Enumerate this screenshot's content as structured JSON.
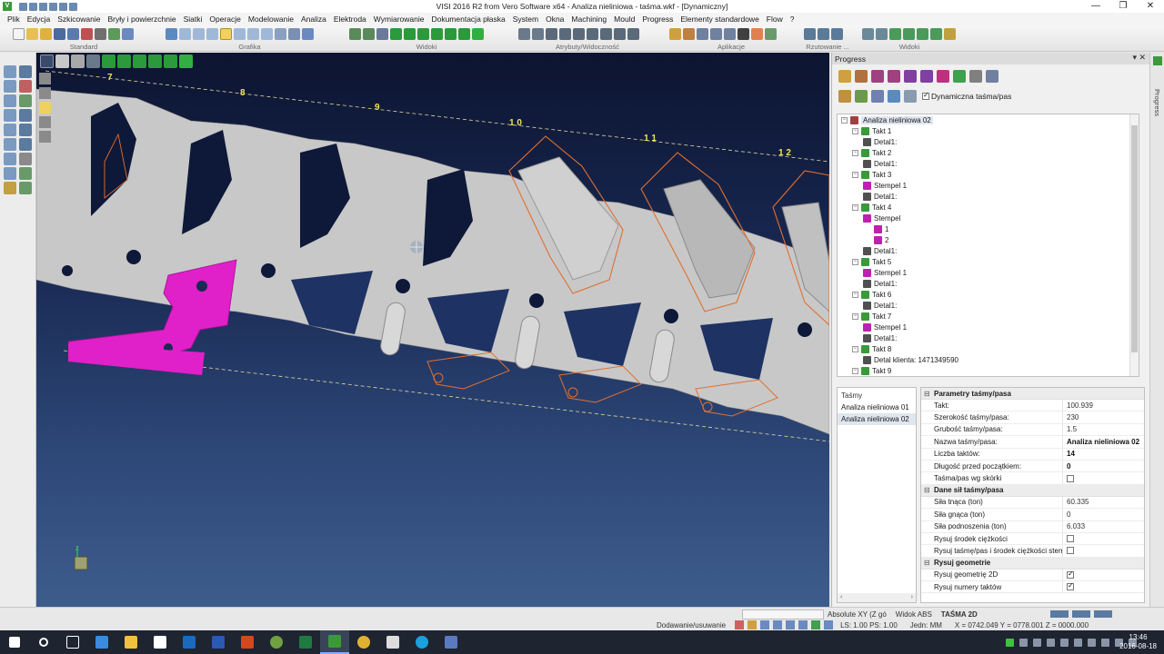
{
  "window": {
    "title": "VISI 2016 R2 from Vero Software x64 - Analiza nieliniowa - taśma.wkf - [Dynamiczny]",
    "minimize": "—",
    "maximize": "❐",
    "close": "✕"
  },
  "menu": [
    "Plik",
    "Edycja",
    "Szkicowanie",
    "Bryły i powierzchnie",
    "Siatki",
    "Operacje",
    "Modelowanie",
    "Analiza",
    "Elektroda",
    "Wymiarowanie",
    "Dokumentacja płaska",
    "System",
    "Okna",
    "Machining",
    "Mould",
    "Progress",
    "Elementy standardowe",
    "Flow",
    "?"
  ],
  "toolbar_groups": [
    "Standard",
    "Grafika",
    "Widoki",
    "Atrybuty/Widoczność",
    "Aplikacje",
    "Rzutowanie ...",
    "Widoki"
  ],
  "viewport": {
    "takt_labels": [
      "7",
      "8",
      "9",
      "1 0",
      "1 1",
      "1 2"
    ],
    "axis_label": "Z"
  },
  "progress_panel": {
    "title": "Progress",
    "panel_controls": "▾ ✕",
    "dynamic_checkbox_label": "Dynamiczna taśma/pas",
    "dynamic_checked": true,
    "tree": [
      {
        "label": "Analiza nieliniowa 02",
        "level": 0,
        "kind": "root"
      },
      {
        "label": "Takt 1",
        "level": 1,
        "kind": "takt"
      },
      {
        "label": "Detal1:",
        "level": 2,
        "kind": "detal"
      },
      {
        "label": "Takt 2",
        "level": 1,
        "kind": "takt"
      },
      {
        "label": "Detal1:",
        "level": 2,
        "kind": "detal"
      },
      {
        "label": "Takt 3",
        "level": 1,
        "kind": "takt"
      },
      {
        "label": "Stempel 1",
        "level": 2,
        "kind": "stempel"
      },
      {
        "label": "Detal1:",
        "level": 2,
        "kind": "detal"
      },
      {
        "label": "Takt 4",
        "level": 1,
        "kind": "takt"
      },
      {
        "label": "Stempel",
        "level": 2,
        "kind": "stempel"
      },
      {
        "label": "1",
        "level": 3,
        "kind": "stempel"
      },
      {
        "label": "2",
        "level": 3,
        "kind": "stempel"
      },
      {
        "label": "Detal1:",
        "level": 2,
        "kind": "detal"
      },
      {
        "label": "Takt 5",
        "level": 1,
        "kind": "takt"
      },
      {
        "label": "Stempel 1",
        "level": 2,
        "kind": "stempel"
      },
      {
        "label": "Detal1:",
        "level": 2,
        "kind": "detal"
      },
      {
        "label": "Takt 6",
        "level": 1,
        "kind": "takt"
      },
      {
        "label": "Detal1:",
        "level": 2,
        "kind": "detal"
      },
      {
        "label": "Takt 7",
        "level": 1,
        "kind": "takt"
      },
      {
        "label": "Stempel 1",
        "level": 2,
        "kind": "stempel"
      },
      {
        "label": "Detal1:",
        "level": 2,
        "kind": "detal"
      },
      {
        "label": "Takt 8",
        "level": 1,
        "kind": "takt"
      },
      {
        "label": "Detal klienta: 1471349590",
        "level": 2,
        "kind": "detal"
      },
      {
        "label": "Takt 9",
        "level": 1,
        "kind": "takt"
      }
    ],
    "tasmy": {
      "header": "Taśmy",
      "items": [
        "Analiza nieliniowa 01",
        "Analiza nieliniowa 02"
      ],
      "selected_index": 1,
      "scroll_left": "‹",
      "scroll_right": "›"
    },
    "props": {
      "sec1": "Parametry taśmy/pasa",
      "sec2": "Dane sił taśmy/pasa",
      "sec3": "Rysuj geometrie",
      "rows1": [
        {
          "k": "Takt:",
          "v": "100.939",
          "bold": false
        },
        {
          "k": "Szerokość taśmy/pasa:",
          "v": "230",
          "bold": false
        },
        {
          "k": "Grubość taśmy/pasa:",
          "v": "1.5",
          "bold": false
        },
        {
          "k": "Nazwa taśmy/pasa:",
          "v": "Analiza nieliniowa 02",
          "bold": true
        },
        {
          "k": "Liczba taktów:",
          "v": "14",
          "bold": true
        },
        {
          "k": "Długość przed początkiem:",
          "v": "0",
          "bold": true
        },
        {
          "k": "Taśma/pas wg skórki",
          "v": "",
          "bold": false,
          "check": false
        }
      ],
      "rows2": [
        {
          "k": "Siła tnąca (ton)",
          "v": "60.335",
          "bold": false
        },
        {
          "k": "Siła gnąca (ton)",
          "v": "0",
          "bold": false
        },
        {
          "k": "Siła podnoszenia (ton)",
          "v": "6.033",
          "bold": false
        },
        {
          "k": "Rysuj środek ciężkości",
          "v": "",
          "bold": false,
          "check": false
        },
        {
          "k": "Rysuj taśmę/pas i środek ciężkości stempli",
          "v": "",
          "bold": false,
          "check": false
        }
      ],
      "rows3": [
        {
          "k": "Rysuj geometrię 2D",
          "v": "",
          "bold": false,
          "check": true
        },
        {
          "k": "Rysuj numery taktów",
          "v": "",
          "bold": false,
          "check": true
        }
      ]
    }
  },
  "side_strip_label": "Progress",
  "status": {
    "coord_mode": "Absolute XY (Z gó",
    "view": "Widok ABS",
    "strip": "TAŚMA 2D",
    "mode": "Dodawanie/usuwanie",
    "ls_ps": "LS: 1.00 PS: 1.00",
    "units": "Jedn: MM",
    "coords": "X = 0742.049 Y = 0778.001 Z = 0000.000"
  },
  "taskbar": {
    "time": "13:46",
    "date": "2016-08-18"
  },
  "colors": {
    "part_fill": "#c8c8c8",
    "contour": "#e07030",
    "highlight": "#e020c8",
    "takt_label": "#f0e060"
  }
}
